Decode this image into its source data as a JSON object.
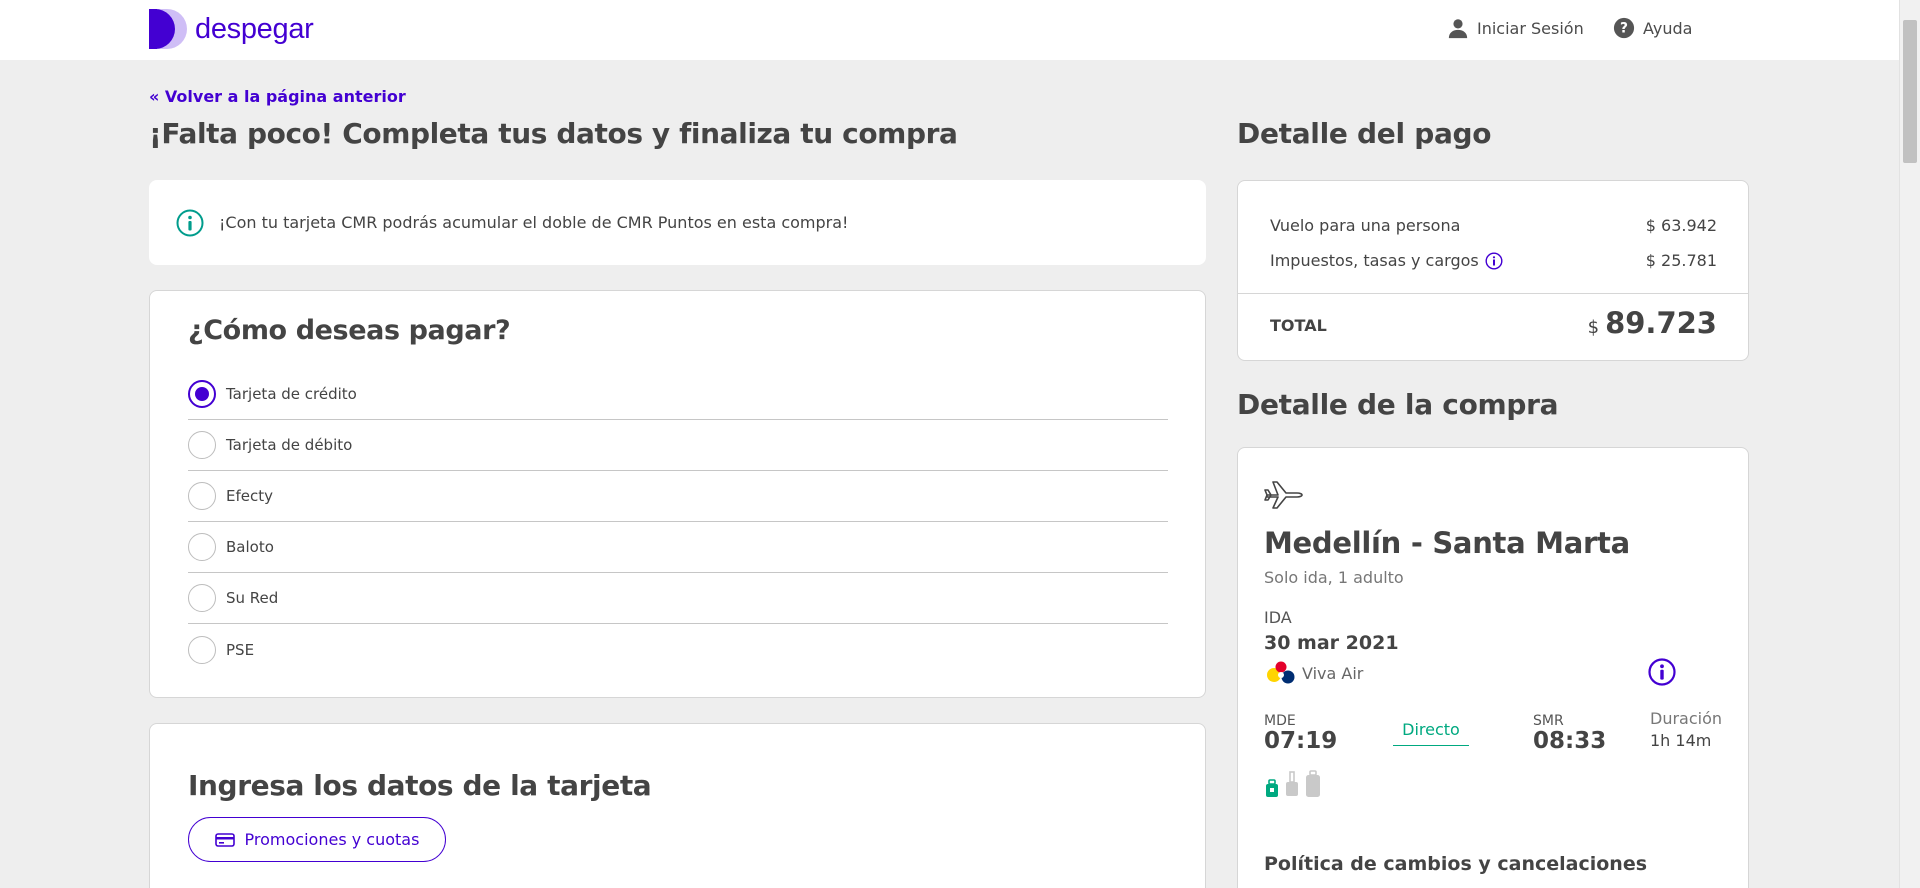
{
  "brand": {
    "name": "despegar",
    "color": "#4300d2"
  },
  "header": {
    "login_label": "Iniciar Sesión",
    "login_icon": "user-icon",
    "help_label": "Ayuda",
    "help_icon": "help-circle-icon"
  },
  "nav": {
    "back_label": "« Volver a la página anterior"
  },
  "page_title": "¡Falta poco! Completa tus datos y finaliza tu compra",
  "notice": {
    "icon": "info-circle-icon",
    "text": "¡Con tu tarjeta CMR podrás acumular el doble de CMR Puntos en esta compra!"
  },
  "payment_methods": {
    "title": "¿Cómo deseas pagar?",
    "selected": "Tarjeta de crédito",
    "options": [
      {
        "label": "Tarjeta de crédito",
        "checked": true
      },
      {
        "label": "Tarjeta de débito",
        "checked": false
      },
      {
        "label": "Efecty",
        "checked": false
      },
      {
        "label": "Baloto",
        "checked": false
      },
      {
        "label": "Su Red",
        "checked": false
      },
      {
        "label": "PSE",
        "checked": false
      }
    ]
  },
  "card_form": {
    "title": "Ingresa los datos de la tarjeta",
    "promo_button": "Promociones y cuotas",
    "promo_icon": "credit-card-icon"
  },
  "payment_detail": {
    "title": "Detalle del pago",
    "rows": [
      {
        "label": "Vuelo para una persona",
        "value": "$ 63.942"
      },
      {
        "label": "Impuestos, tasas y cargos",
        "value": "$ 25.781"
      }
    ],
    "total_label": "TOTAL",
    "total_currency": "$",
    "total_value": "89.723"
  },
  "purchase_detail": {
    "title": "Detalle de la compra",
    "route": "Medellín - Santa Marta",
    "trip_type": "Solo ida, 1 adulto",
    "leg_label": "IDA",
    "date": "30 mar 2021",
    "airline": "Viva Air",
    "origin_code": "MDE",
    "origin_time": "07:19",
    "stops": "Directo",
    "dest_code": "SMR",
    "dest_time": "08:33",
    "duration_label": "Duración",
    "duration": "1h 14m",
    "baggage": {
      "personal_item": true,
      "carry_on": false,
      "checked_bag": false
    },
    "policy_title": "Política de cambios y cancelaciones"
  }
}
